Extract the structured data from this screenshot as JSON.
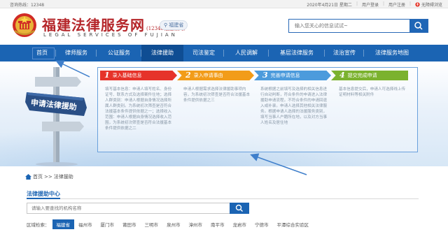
{
  "topbar": {
    "hotline": "咨询热线：12348",
    "date": "2020年4月21日 星期二",
    "links": [
      "用户登录",
      "用户注册",
      "无障碍浏览"
    ],
    "accessibility_icon": "accessibility-icon"
  },
  "header": {
    "title": "福建法律服务网",
    "subtitle": "(12348福建法网)",
    "english": "LEGAL SERVICES OF FUJIAN",
    "location": "福建省",
    "search_placeholder": "输入您关心的信息试试~"
  },
  "nav": {
    "items": [
      "首页",
      "律师服务",
      "公证服务",
      "法律援助",
      "司法鉴定",
      "人民调解",
      "基层法律服务",
      "法治宣传",
      "法律服务地图"
    ],
    "active": "法律援助"
  },
  "hero": {
    "sign_text": "申请法律援助",
    "steps": [
      {
        "num": "1",
        "label": "录入基础信息",
        "desc": "填写基本信息：申请人填写姓名、身份证号、联系方式及选择案件住地；选择人群类别：申请人根据自身情况选择所属人群类别。为系统初次筛查是否符合法援基本条件提供依据之一；选择收入范围：申请人根据自身情况选择收入范围，为系统初次筛查是否符合法援基本条件提供依据之二"
      },
      {
        "num": "2",
        "label": "录入申请事由",
        "desc": "申请人根据需求选择法律援助事项内容，为系统初次筛查是否符合法援基本条件提供依据之三"
      },
      {
        "num": "3",
        "label": "完善申请信息",
        "desc": "系统根据之前填写及选择的相关信息进行自动判断，符合条件的申请进入法律援助申请流程。不符合条件的申请回退入或补录。申请人选择其他相关法律服务。根据申请人选择的法援服务类别，填写当事人户籍所在地，以及对方当事人姓名及居住地"
      },
      {
        "num": "4",
        "label": "提交完成申请",
        "desc": "基本信息提交后，申请人可选择线上传证明材料等相关附件"
      }
    ]
  },
  "breadcrumb": {
    "home": "首页",
    "separator": ">>",
    "current": "法律援助"
  },
  "center": {
    "title": "法律援助中心",
    "search_placeholder": "请输入要查找的机构名称",
    "region_label": "区域检索：",
    "regions": [
      "福建省",
      "福州市",
      "厦门市",
      "莆田市",
      "三明市",
      "泉州市",
      "漳州市",
      "南平市",
      "龙岩市",
      "宁德市",
      "平潭综合实验区"
    ],
    "active_region": "福建省"
  },
  "colors": {
    "brand_red": "#b5262a",
    "nav_blue": "#1b64b3",
    "step1": "#e6332a",
    "step2": "#f29c19",
    "step3": "#4c9bdc",
    "step4": "#7bb22e"
  }
}
